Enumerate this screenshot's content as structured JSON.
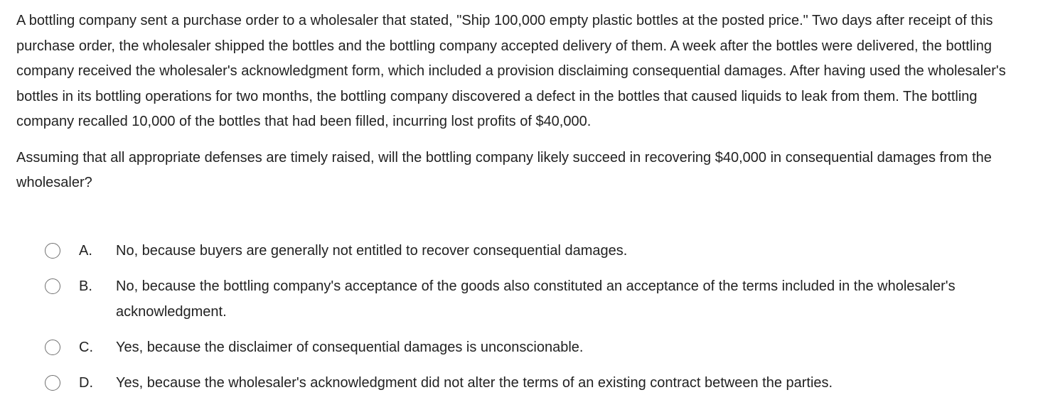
{
  "question": {
    "stem_paragraphs": [
      "A bottling company sent a purchase order to a wholesaler that stated, \"Ship 100,000 empty plastic bottles at the posted price.\" Two days after receipt of this purchase order, the wholesaler shipped the bottles and the bottling company accepted delivery of them. A week after the bottles were delivered, the bottling company received the wholesaler's acknowledgment form, which included a provision disclaiming consequential damages. After having used the wholesaler's bottles in its bottling operations for two months, the bottling company discovered a defect in the bottles that caused liquids to leak from them. The bottling company recalled 10,000 of the bottles that had been filled, incurring lost profits of $40,000.",
      "Assuming that all appropriate defenses are timely raised, will the bottling company likely succeed in recovering $40,000 in consequential damages from the wholesaler?"
    ],
    "options": [
      {
        "letter": "A.",
        "text": "No, because buyers are generally not entitled to recover consequential damages."
      },
      {
        "letter": "B.",
        "text": "No, because the bottling company's acceptance of the goods also constituted an acceptance of the terms included in the wholesaler's acknowledgment."
      },
      {
        "letter": "C.",
        "text": "Yes, because the disclaimer of consequential damages is unconscionable."
      },
      {
        "letter": "D.",
        "text": "Yes, because the wholesaler's acknowledgment did not alter the terms of an existing contract between the parties."
      }
    ]
  }
}
